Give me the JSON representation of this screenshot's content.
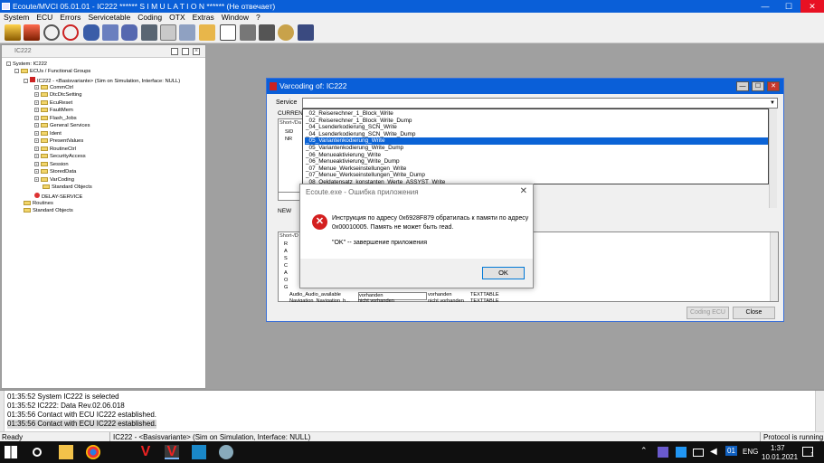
{
  "app": {
    "title": "Ecoute/MVCI 05.01.01 - IC222 ******   S I M U L A T I O N ****** (Не отвечает)",
    "menu": [
      "System",
      "ECU",
      "Errors",
      "Servicetable",
      "Coding",
      "OTX",
      "Extras",
      "Window",
      "?"
    ],
    "window_controls": {
      "minimize": "—",
      "maximize": "☐",
      "close": "✕"
    }
  },
  "tree": {
    "header": "IC222",
    "items": [
      "System: IC222",
      "ECUs / Functional Groups",
      "IC222 - <Basisvariante> (Sim on Simulation, Interface: NULL)",
      "CommCtrl",
      "DtcDtcSetting",
      "EcuReset",
      "FaultMem",
      "Flash_Jobs",
      "General Services",
      "Ident",
      "PresentValues",
      "RoutineCtrl",
      "SecurityAccess",
      "Session",
      "StoredData",
      "VarCoding",
      "Standard Objects",
      "DELAY-SERVICE",
      "Routines",
      "Standard Objects"
    ]
  },
  "varcoding": {
    "title": "Varcoding of: IC222",
    "service_label": "Service",
    "dropdown_items": [
      "_02_Reiserechner_1_Block_Write",
      "_02_Reiserechner_1_Block_Write_Dump",
      "_04_Lsenderkodierung_SCN_Write",
      "_04_Lsenderkodierung_SCN_Write_Dump",
      "_05_Variantenkodierung_Write",
      "_05_Variantenkodierung_Write_Dump",
      "_06_Menueaktivierung_Write",
      "_06_Menueaktivierung_Write_Dump",
      "_07_Menue_Werkseinstellungen_Write",
      "_07_Menue_Werkseinstellungen_Write_Dump",
      "_08_Oeldatensatz_konstanten_Werte_ASSYST_Write"
    ],
    "selected_index": 4,
    "current_group": "CURREN",
    "current_col": "Short-/Da",
    "current_rows": [
      "SID",
      "NR"
    ],
    "new_group": "NEW",
    "new_col": "Short-/D",
    "new_rows": [
      "R",
      "A",
      "S",
      "C",
      "A",
      "O",
      "G"
    ],
    "audio_row": {
      "name": "Audio_Audio_available",
      "value": "vorhanden",
      "value2": "vorhanden",
      "type": "TEXTTABLE"
    },
    "partial_row": {
      "name": "Navigation_Navigation_h...",
      "value": "nicht vorhanden",
      "value2": "nicht vorhanden",
      "type": "TEXTTABLE"
    },
    "coding_button": "Coding ECU",
    "close_button": "Close"
  },
  "error_dialog": {
    "title": "Ecoute.exe - Ошибка приложения",
    "line1": "Инструкция по адресу 0x6928F879 обратилась к памяти по адресу",
    "line2": "0x00010005. Память не может быть read.",
    "line3": "\"OK\" -- завершение приложения",
    "ok_label": "OK"
  },
  "log": [
    "01:35:52 System IC222 is selected",
    "01:35:52 IC222: Data Rev.02.06.018",
    "01:35:56 Contact with ECU IC222 established.",
    "01:35:56 Contact with ECU IC222 established."
  ],
  "status": {
    "left": "Ready",
    "middle": "IC222 - <Basisvariante> (Sim on Simulation, Interface: NULL)",
    "right": "Protocol is running"
  },
  "taskbar": {
    "lang": "ENG",
    "time": "1:37",
    "date": "10.01.2021",
    "badge": "01",
    "notification_count": "1"
  }
}
